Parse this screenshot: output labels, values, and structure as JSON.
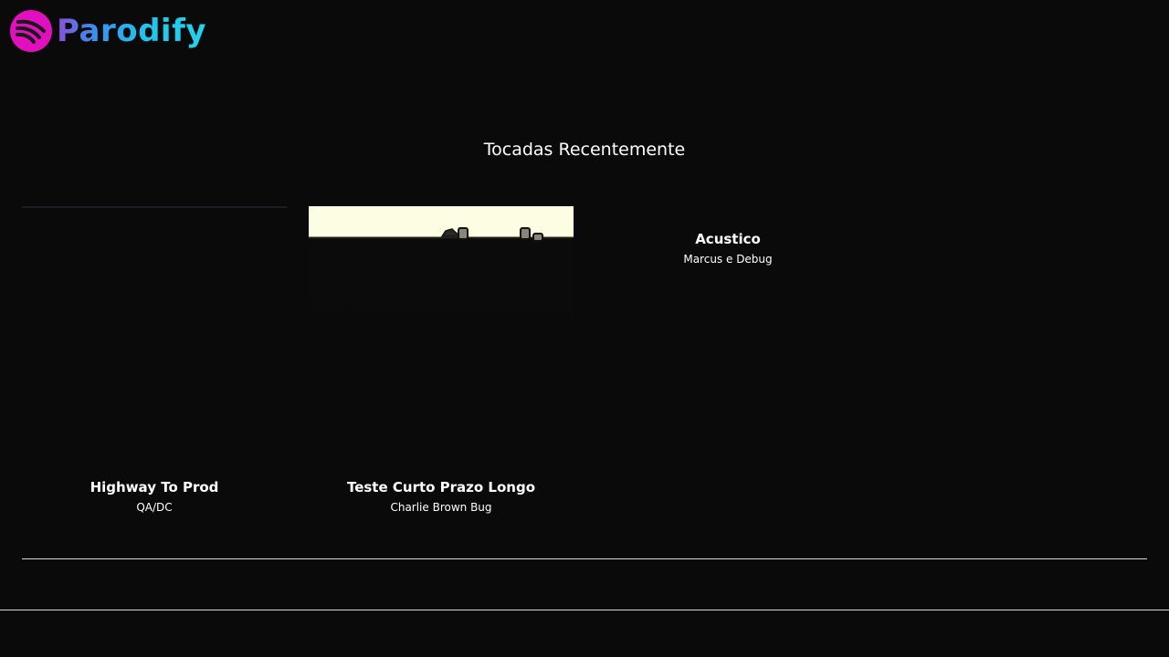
{
  "app": {
    "name": "Parodify",
    "logo_icon": "parodify-logo-icon",
    "brand_color": "#e20fbf",
    "accent_color": "#20c5ec"
  },
  "recent": {
    "title": "Tocadas Recentemente",
    "items": [
      {
        "title": "Highway To Prod",
        "artist": "QA/DC",
        "cover_icon": "album-cover"
      },
      {
        "title": "Teste Curto Prazo Longo",
        "artist": "Charlie Brown Bug",
        "cover_icon": "album-cover"
      },
      {
        "title": "Acustico",
        "artist": "Marcus e Debug",
        "cover_icon": "album-cover-missing"
      }
    ]
  }
}
